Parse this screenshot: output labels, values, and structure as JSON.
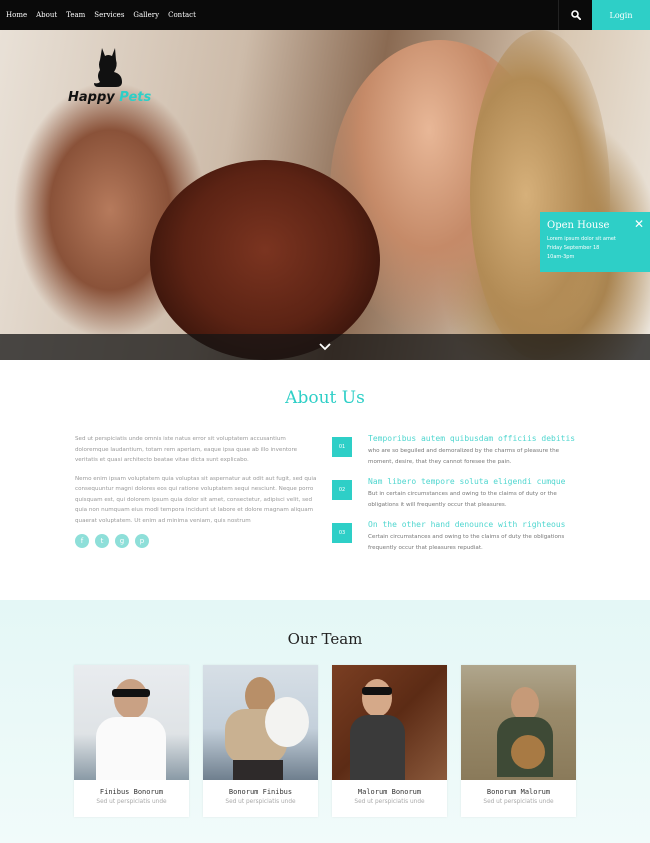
{
  "nav": {
    "links": [
      "Home",
      "About",
      "Team",
      "Services",
      "Gallery",
      "Contact"
    ],
    "login_label": "Login",
    "search_icon": "search-icon"
  },
  "hero": {
    "logo": {
      "text_part1": "Happy",
      "text_part2": "Pets",
      "icon": "cat-silhouette"
    },
    "open_house": {
      "title": "Open House",
      "line1": "Lorem ipsum dolor sit amet",
      "line2": "Friday September 18",
      "line3": "10am-3pm"
    },
    "scroll_icon": "chevron-down-icon"
  },
  "about": {
    "title": "About Us",
    "paragraphs": [
      "Sed ut perspiciatis unde omnis iste natus error sit voluptatem accusantium doloremque laudantium, totam rem aperiam, eaque ipsa quae ab illo inventore veritatis et quasi architecto beatae vitae dicta sunt explicabo.",
      "Nemo enim ipsam voluptatem quia voluptas sit aspernatur aut odit aut fugit, sed quia consequuntur magni dolores eos qui ratione voluptatem sequi nesciunt. Neque porro quisquam est, qui dolorem ipsum quia dolor sit amet, consectetur, adipisci velit, sed quia non numquam eius modi tempora incidunt ut labore et dolore magnam aliquam quaerat voluptatem. Ut enim ad minima veniam, quis nostrum"
    ],
    "socials": [
      "f",
      "t",
      "g",
      "p"
    ],
    "features": [
      {
        "num": "01",
        "title": "Temporibus autem quibusdam officiis debitis",
        "desc": "who are so beguiled and demoralized by the charms of pleasure the moment, desire, that they cannot foresee the pain."
      },
      {
        "num": "02",
        "title": "Nam libero tempore soluta eligendi cumque",
        "desc": "But in certain circumstances and owing to the claims of duty or the obligations it will frequently occur that pleasures."
      },
      {
        "num": "03",
        "title": "On the other hand denounce with righteous",
        "desc": "Certain circumstances and owing to the claims of duty the obligations frequently occur that pleasures repudiat."
      }
    ]
  },
  "team": {
    "title": "Our Team",
    "members": [
      {
        "name": "Finibus Bonorum",
        "subtitle": "Sed ut perspiciatis unde"
      },
      {
        "name": "Bonorum Finibus",
        "subtitle": "Sed ut perspiciatis unde"
      },
      {
        "name": "Malorum Bonorum",
        "subtitle": "Sed ut perspiciatis unde"
      },
      {
        "name": "Bonorum Malorum",
        "subtitle": "Sed ut perspiciatis unde"
      }
    ]
  },
  "colors": {
    "accent": "#2ecfc7",
    "nav_bg": "#0a0a0a",
    "team_bg": "#e4f7f6"
  }
}
